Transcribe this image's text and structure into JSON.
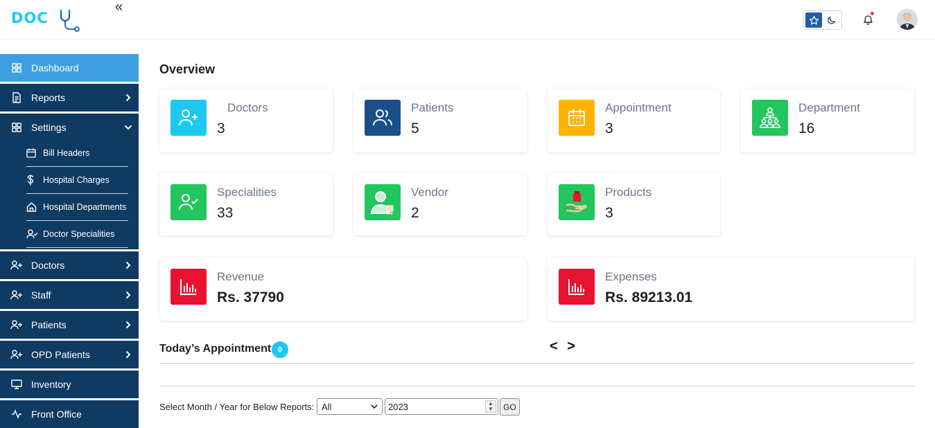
{
  "brand": {
    "logo_text": "DOC"
  },
  "header": {
    "collapse_icon": "double-chevron-left-icon",
    "theme_light_icon": "star-icon",
    "theme_dark_icon": "moon-icon",
    "notification_icon": "bell-icon"
  },
  "sidebar": {
    "items": [
      {
        "label": "Dashboard",
        "icon": "grid-icon"
      },
      {
        "label": "Reports",
        "icon": "document-icon"
      },
      {
        "label": "Settings",
        "icon": "grid-icon"
      },
      {
        "label": "Doctors",
        "icon": "user-plus-icon"
      },
      {
        "label": "Staff",
        "icon": "user-plus-icon"
      },
      {
        "label": "Patients",
        "icon": "user-plus-icon"
      },
      {
        "label": "OPD Patients",
        "icon": "user-plus-icon"
      },
      {
        "label": "Inventory",
        "icon": "monitor-icon"
      },
      {
        "label": "Front Office",
        "icon": "activity-icon"
      }
    ],
    "settings_sub": [
      {
        "label": "Bill Headers",
        "icon": "calendar-icon"
      },
      {
        "label": "Hospital Charges",
        "icon": "dollar-icon"
      },
      {
        "label": "Hospital Departments",
        "icon": "home-icon"
      },
      {
        "label": "Doctor Specialities",
        "icon": "user-check-icon"
      }
    ]
  },
  "main": {
    "title": "Overview",
    "cards": [
      {
        "title": "Doctors",
        "value": "3",
        "color": "#1ec9f0"
      },
      {
        "title": "Patients",
        "value": "5",
        "color": "#1a4f8b"
      },
      {
        "title": "Appointment",
        "value": "3",
        "color": "#ffb300"
      },
      {
        "title": "Department",
        "value": "16",
        "color": "#22c55e"
      },
      {
        "title": "Specialities",
        "value": "33",
        "color": "#22c55e"
      },
      {
        "title": "Vendor",
        "value": "2",
        "color": "#22c55e"
      },
      {
        "title": "Products",
        "value": "3",
        "color": "#22c55e"
      },
      {
        "title": "Revenue",
        "value": "Rs. 37790",
        "color": "#e8132f"
      },
      {
        "title": "Expenses",
        "value": "Rs. 89213.01",
        "color": "#e8132f"
      }
    ],
    "today": {
      "title": "Today’s Appointment",
      "count": "0",
      "nav": "< >"
    },
    "report_filter": {
      "label": "Select Month / Year for Below Reports:",
      "month": "All",
      "year": "2023",
      "go": "GO"
    }
  }
}
